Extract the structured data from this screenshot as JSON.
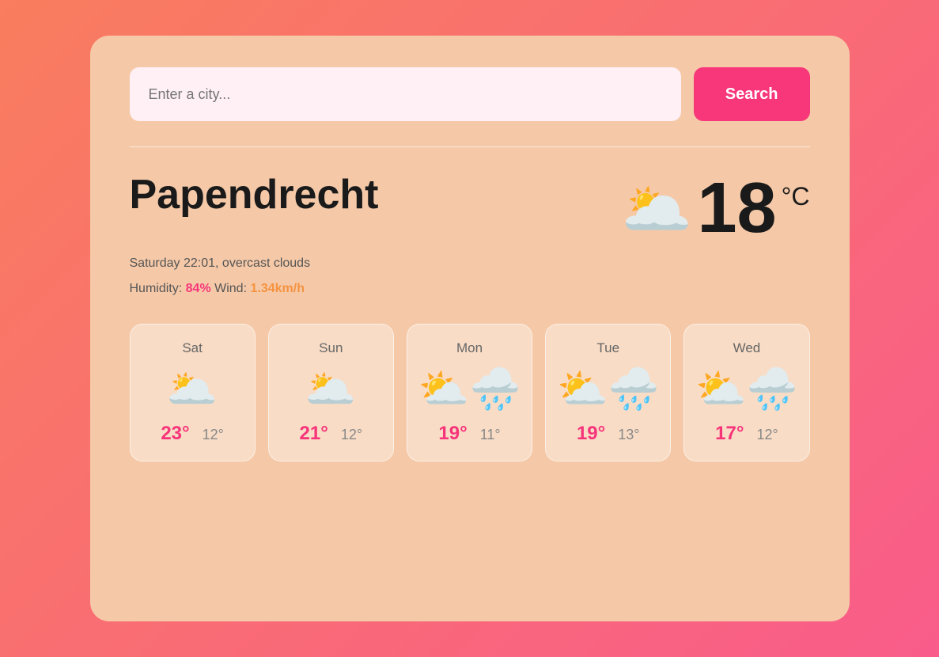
{
  "search": {
    "placeholder": "Enter a city...",
    "button_label": "Search"
  },
  "current": {
    "city": "Papendrecht",
    "datetime": "Saturday 22:01, overcast clouds",
    "humidity_label": "Humidity:",
    "humidity_value": "84%",
    "wind_label": "Wind:",
    "wind_value": "1.34km/h",
    "temperature": "18",
    "temp_unit": "°C",
    "weather_icon": "🌥️"
  },
  "forecast": [
    {
      "day": "Sat",
      "icon": "🌥️",
      "high": "23°",
      "low": "12°"
    },
    {
      "day": "Sun",
      "icon": "🌥️",
      "high": "21°",
      "low": "12°"
    },
    {
      "day": "Mon",
      "icon": "⛅🌧️",
      "high": "19°",
      "low": "11°"
    },
    {
      "day": "Tue",
      "icon": "⛅🌧️",
      "high": "19°",
      "low": "13°"
    },
    {
      "day": "Wed",
      "icon": "⛅🌧️",
      "high": "17°",
      "low": "12°"
    }
  ]
}
